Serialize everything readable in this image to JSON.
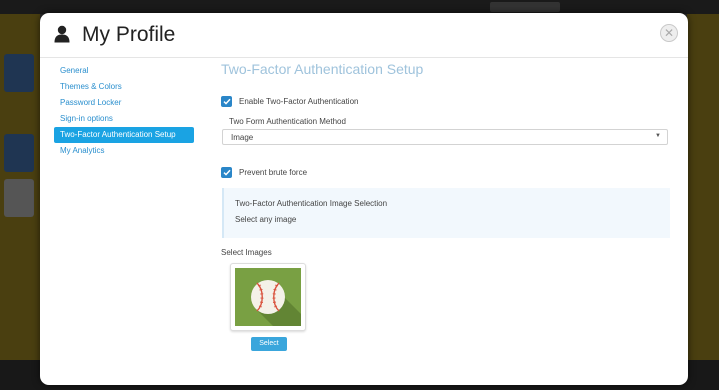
{
  "modal": {
    "title": "My Profile",
    "close_icon": "close-icon",
    "user_icon": "user-icon"
  },
  "nav": {
    "items": [
      {
        "label": "General",
        "active": false
      },
      {
        "label": "Themes & Colors",
        "active": false
      },
      {
        "label": "Password Locker",
        "active": false
      },
      {
        "label": "Sign-in options",
        "active": false
      },
      {
        "label": "Two-Factor Authentication Setup",
        "active": true
      },
      {
        "label": "My Analytics",
        "active": false
      }
    ]
  },
  "content": {
    "section_title": "Two-Factor Authentication Setup",
    "enable_2fa": {
      "label": "Enable Two-Factor Authentication",
      "checked": true
    },
    "method_label": "Two Form Authentication Method",
    "method_value": "Image",
    "prevent_brute_force": {
      "label": "Prevent brute force",
      "checked": true
    },
    "info": {
      "title": "Two-Factor Authentication Image Selection",
      "subtitle": "Select any image"
    },
    "select_images_label": "Select Images",
    "image_icon": "baseball-icon",
    "select_button": "Select"
  },
  "colors": {
    "accent": "#1aa3e3",
    "link": "#2a8fce",
    "title_muted": "#9fc3dc",
    "checkbox": "#2a86c8",
    "thumb_bg": "#79a043"
  }
}
